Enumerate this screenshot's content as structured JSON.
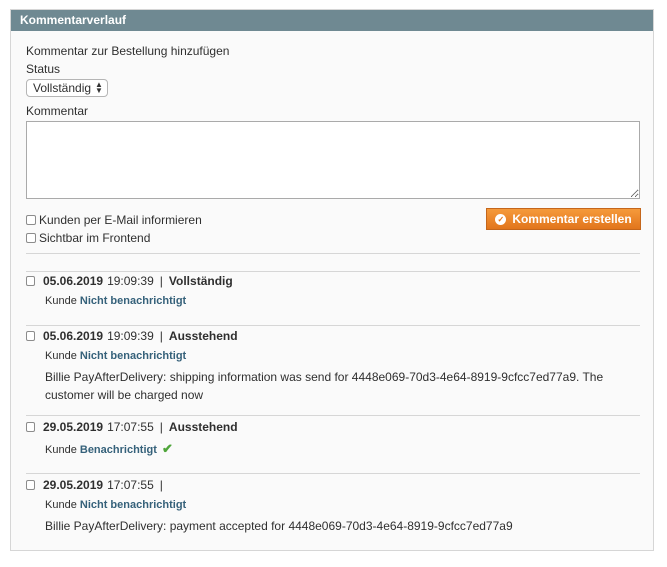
{
  "header": {
    "title": "Kommentarverlauf"
  },
  "form": {
    "add_title": "Kommentar zur Bestellung hinzufügen",
    "status_label": "Status",
    "status_value": "Vollständig",
    "comment_label": "Kommentar",
    "notify_label": "Kunden per E-Mail informieren",
    "visible_label": "Sichtbar im Frontend",
    "submit_label": "Kommentar erstellen"
  },
  "history": [
    {
      "date": "05.06.2019",
      "time": "19:09:39",
      "status": "Vollständig",
      "customer": "Kunde",
      "notified": "Nicht benachrichtigt",
      "text": ""
    },
    {
      "date": "05.06.2019",
      "time": "19:09:39",
      "status": "Ausstehend",
      "customer": "Kunde",
      "notified": "Nicht benachrichtigt",
      "text": "Billie PayAfterDelivery: shipping information was send for 4448e069-70d3-4e64-8919-9cfcc7ed77a9. The customer will be charged now"
    },
    {
      "date": "29.05.2019",
      "time": "17:07:55",
      "status": "Ausstehend",
      "customer": "Kunde",
      "notified": "Benachrichtigt",
      "text": ""
    },
    {
      "date": "29.05.2019",
      "time": "17:07:55",
      "status": "",
      "customer": "Kunde",
      "notified": "Nicht benachrichtigt",
      "text": "Billie PayAfterDelivery: payment accepted for 4448e069-70d3-4e64-8919-9cfcc7ed77a9"
    }
  ],
  "icons": {
    "submit": "check-circle-icon",
    "notified": "checkmark-icon"
  },
  "colors": {
    "header": "#6f8992",
    "button": "#e2751c",
    "link": "#35617a",
    "check": "#4fa53a"
  }
}
